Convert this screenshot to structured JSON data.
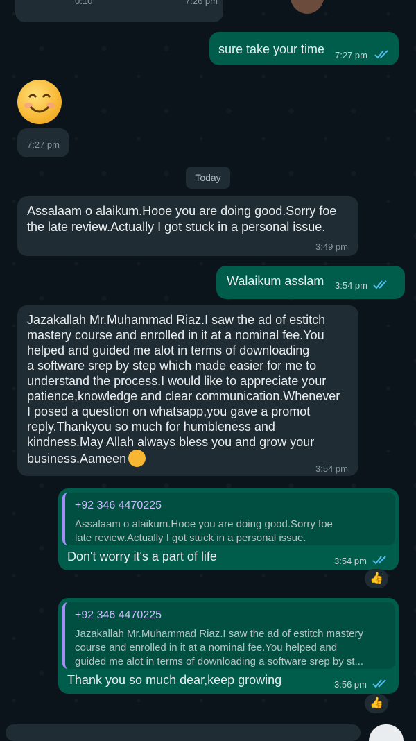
{
  "messages": {
    "top_partial": {
      "left_time": "0:10",
      "right_time": "7:26 pm"
    },
    "m1": {
      "text": "sure take your time",
      "time": "7:27 pm"
    },
    "m2": {
      "emoji": "smiling-face",
      "time": "7:27 pm"
    },
    "day_label": "Today",
    "m3": {
      "text_lines": [
        "Assalaam o alaikum.Hooe you are doing good.Sorry foe",
        "the late review.Actually I got stuck in a personal issue."
      ],
      "time": "3:49 pm"
    },
    "m4": {
      "text": "Walaikum asslam",
      "time": "3:54 pm"
    },
    "m5": {
      "text_lines": [
        "Jazakallah Mr.Muhammad Riaz.I saw the ad of estitch",
        "mastery course and enrolled in it at a nominal fee.You",
        "helped and guided me alot in terms of  downloading",
        "a software srep by step which made easier for me to",
        "understand the process.I would like to appreciate your",
        "patience,knowledge and clear communication.Whenever",
        "I posed a question on whatsapp,you gave a promot",
        "reply.Thankyou so much for humbleness and",
        "kindness.May Allah always bless you and grow your",
        "business.Aameen"
      ],
      "time": "3:54 pm"
    },
    "m6": {
      "quote_sender": "+92 346 4470225",
      "quote_lines": [
        "Assalaam o alaikum.Hooe you are doing good.Sorry foe",
        "late review.Actually I got stuck in a personal issue."
      ],
      "text": "Don't worry it's a part of life",
      "time": "3:54 pm",
      "reaction": "👍"
    },
    "m7": {
      "quote_sender": "+92 346 4470225",
      "quote_lines": [
        "Jazakallah Mr.Muhammad Riaz.I saw the ad of estitch mastery",
        "course and enrolled in it at a nominal fee.You helped and",
        "guided me alot in terms of  downloading a software srep by st..."
      ],
      "text": "Thank you so much dear,keep growing",
      "time": "3:56 pm",
      "reaction": "👍"
    }
  },
  "colors": {
    "incoming": "#1f2c33",
    "outgoing": "#005c4b",
    "read_tick": "#53bdeb",
    "quote_bar": "#a78bfa"
  }
}
